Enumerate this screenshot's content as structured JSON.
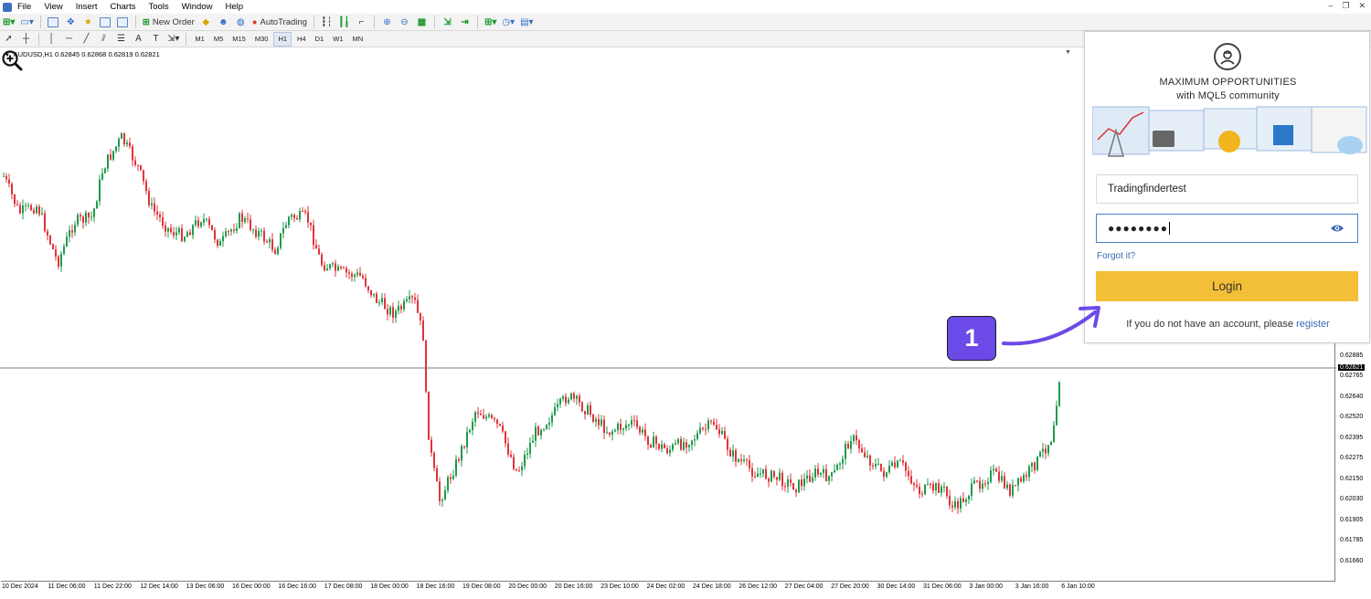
{
  "menu": {
    "items": [
      "File",
      "View",
      "Insert",
      "Charts",
      "Tools",
      "Window",
      "Help"
    ],
    "window_controls": [
      "‒",
      "❐",
      "✕"
    ]
  },
  "toolbar": {
    "new_order_label": "New Order",
    "autotrading_label": "AutoTrading"
  },
  "timeframes": [
    "M1",
    "M5",
    "M15",
    "M30",
    "H1",
    "H4",
    "D1",
    "W1",
    "MN"
  ],
  "active_timeframe": "H1",
  "chart": {
    "symbol_info": "AUDUSD,H1  0.62845 0.62868 0.62819 0.62821",
    "current_price": "0.62821",
    "price_labels": [
      "0.62885",
      "0.62821",
      "0.62765",
      "0.62640",
      "0.62520",
      "0.62395",
      "0.62275",
      "0.62150",
      "0.62030",
      "0.61905",
      "0.61785",
      "0.61660"
    ],
    "time_labels": [
      "10 Dec 2024",
      "11 Dec 06:00",
      "11 Dec 22:00",
      "12 Dec 14:00",
      "13 Dec 06:00",
      "16 Dec 00:00",
      "16 Dec 16:00",
      "17 Dec 08:00",
      "18 Dec 00:00",
      "18 Dec 16:00",
      "19 Dec 08:00",
      "20 Dec 00:00",
      "20 Dec 16:00",
      "23 Dec 10:00",
      "24 Dec 02:00",
      "24 Dec 18:00",
      "26 Dec 12:00",
      "27 Dec 04:00",
      "27 Dec 20:00",
      "30 Dec 14:00",
      "31 Dec 06:00",
      "3 Jan 00:00",
      "3 Jan 16:00",
      "6 Jan 10:00"
    ],
    "colors": {
      "bull": "#1f9a4a",
      "bear": "#e0333a",
      "grid": "#7f7f7f"
    }
  },
  "login_panel": {
    "title_line1": "MAXIMUM OPPORTUNITIES",
    "title_line2": "with MQL5 community",
    "username": "Tradingfindertest",
    "password_mask": "●●●●●●●●",
    "forgot_label": "Forgot it?",
    "login_button": "Login",
    "register_prefix": "If you do not have an account, please",
    "register_link": "register",
    "accent_color": "#f3bf36"
  },
  "annotation": {
    "step_number": "1",
    "badge_color": "#6c4ae7"
  },
  "icons": [
    "avatar-icon",
    "eye-icon",
    "zoom-in-icon",
    "new-chart-icon",
    "autotrading-icon",
    "cursor-icon",
    "crosshair-icon"
  ]
}
